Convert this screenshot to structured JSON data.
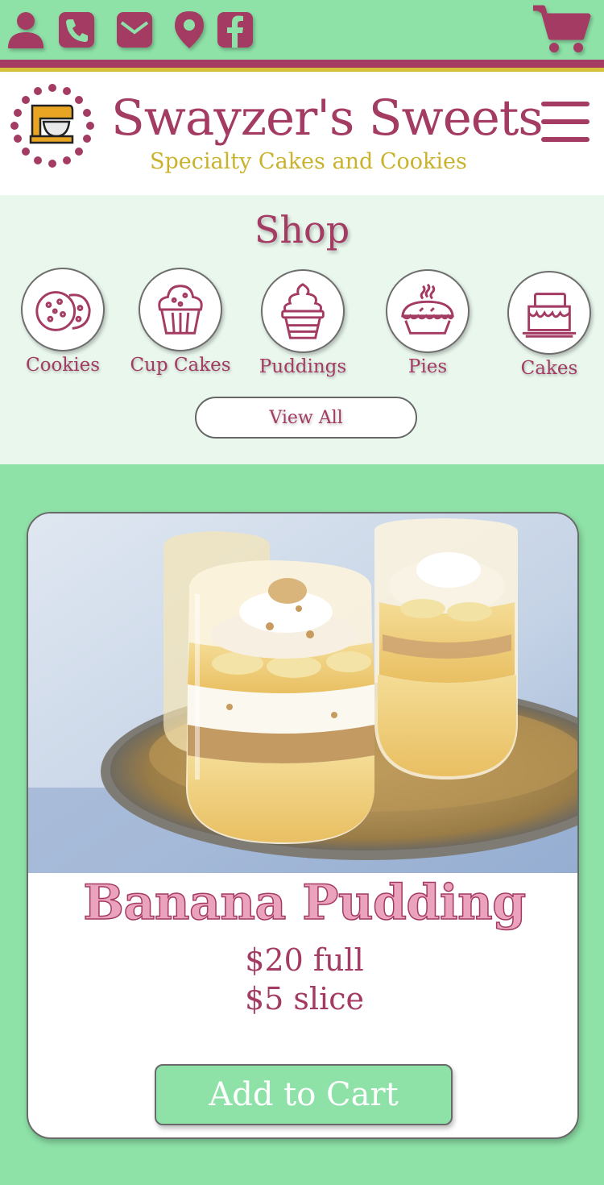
{
  "colors": {
    "brand": "#a33b63",
    "accent_gold": "#d8c23a",
    "mint": "#8ee2a8",
    "shop_bg": "#e9f7ed"
  },
  "topbar": {
    "icons": [
      "user-icon",
      "phone-icon",
      "email-icon",
      "location-icon",
      "facebook-icon",
      "cart-icon"
    ]
  },
  "header": {
    "brand_name": "Swayzer's Sweets",
    "tagline": "Specialty Cakes and Cookies",
    "logo_icon": "stand-mixer-icon",
    "menu_icon": "hamburger-menu-icon"
  },
  "shop": {
    "title": "Shop",
    "categories": [
      {
        "label": "Cookies",
        "icon": "cookies-icon"
      },
      {
        "label": "Cup Cakes",
        "icon": "cupcake-icon"
      },
      {
        "label": "Puddings",
        "icon": "pudding-icon"
      },
      {
        "label": "Pies",
        "icon": "pie-icon"
      },
      {
        "label": "Cakes",
        "icon": "cake-icon"
      }
    ],
    "view_all": "View All"
  },
  "product": {
    "name": "Banana Pudding",
    "price_full": "$20 full",
    "price_slice": "$5 slice",
    "add_to_cart": "Add to Cart"
  }
}
